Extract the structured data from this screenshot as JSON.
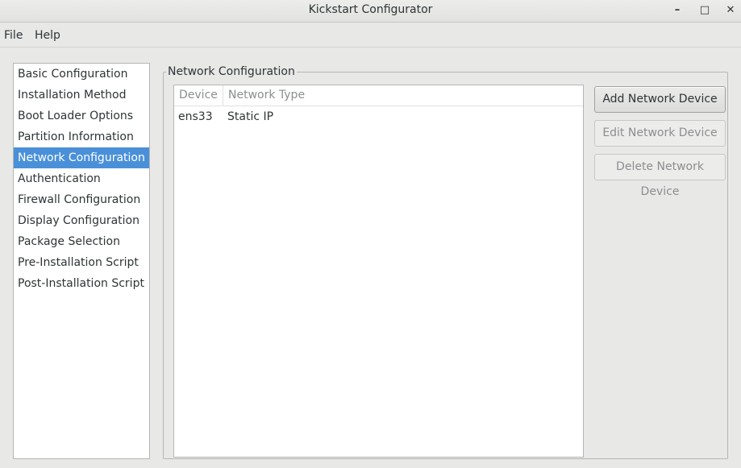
{
  "window": {
    "title": "Kickstart Configurator",
    "minimize_glyph": "–",
    "maximize_glyph": "□",
    "close_glyph": "✕"
  },
  "menubar": {
    "items": [
      {
        "label": "File"
      },
      {
        "label": "Help"
      }
    ]
  },
  "sidebar": {
    "selected": "Network Configuration",
    "items": [
      {
        "label": "Basic Configuration"
      },
      {
        "label": "Installation Method"
      },
      {
        "label": "Boot Loader Options"
      },
      {
        "label": "Partition Information"
      },
      {
        "label": "Network Configuration"
      },
      {
        "label": "Authentication"
      },
      {
        "label": "Firewall Configuration"
      },
      {
        "label": "Display Configuration"
      },
      {
        "label": "Package Selection"
      },
      {
        "label": "Pre-Installation Script"
      },
      {
        "label": "Post-Installation Script"
      }
    ]
  },
  "network": {
    "section_title": "Network Configuration",
    "columns": [
      "Device",
      "Network Type"
    ],
    "rows": [
      {
        "device": "ens33",
        "type": "Static IP"
      }
    ],
    "buttons": {
      "add": "Add Network Device",
      "edit": "Edit Network Device",
      "delete": "Delete Network Device"
    }
  },
  "colors": {
    "selection": "#4a90d9",
    "window_bg": "#e8e8e7"
  }
}
